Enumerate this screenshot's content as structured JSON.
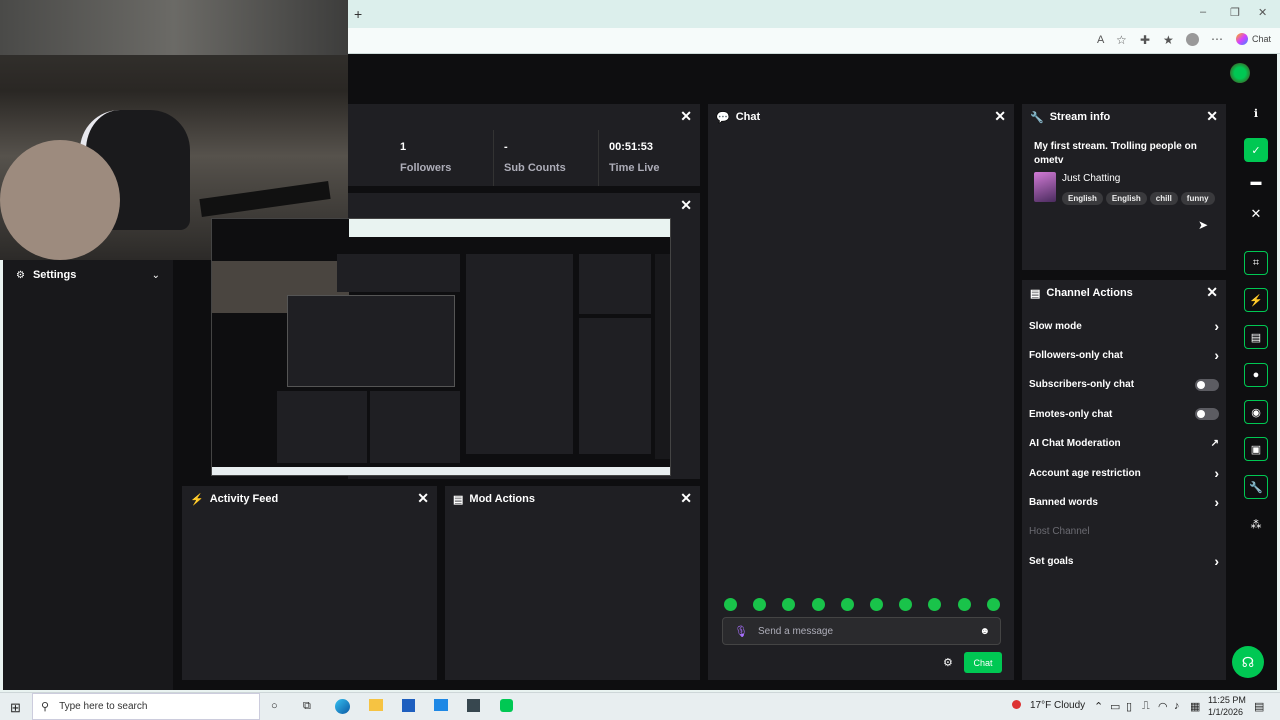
{
  "browser": {
    "new_tab": "+",
    "chat_label": "Chat",
    "window_controls": [
      "–",
      "❐",
      "✕"
    ]
  },
  "stats": {
    "panel_close": "✕",
    "followers_value": "1",
    "followers_label": "Followers",
    "subs_value": "-",
    "subs_label": "Sub Counts",
    "time_value": "00:51:53",
    "time_label": "Time Live"
  },
  "sidebar": {
    "settings_label": "Settings"
  },
  "chat": {
    "title": "Chat",
    "placeholder": "Send a message",
    "send_label": "Chat",
    "emote_count": 10
  },
  "stream_info": {
    "title": "Stream info",
    "stream_title": "My first stream. Trolling people on ometv",
    "category": "Just Chatting",
    "tags": [
      "English",
      "English",
      "chill",
      "funny"
    ]
  },
  "channel_actions": {
    "title": "Channel Actions",
    "items": [
      {
        "label": "Slow mode",
        "control": "chevron"
      },
      {
        "label": "Followers-only chat",
        "control": "chevron"
      },
      {
        "label": "Subscribers-only chat",
        "control": "toggle"
      },
      {
        "label": "Emotes-only chat",
        "control": "toggle"
      },
      {
        "label": "AI Chat Moderation",
        "control": "external"
      },
      {
        "label": "Account age restriction",
        "control": "chevron"
      },
      {
        "label": "Banned words",
        "control": "chevron"
      },
      {
        "label": "Host Channel",
        "control": "none"
      },
      {
        "label": "Set goals",
        "control": "chevron"
      }
    ]
  },
  "activity_feed": {
    "title": "Activity Feed"
  },
  "mod_actions": {
    "title": "Mod Actions"
  },
  "taskbar": {
    "search_placeholder": "Type here to search",
    "weather_temp": "17°F",
    "weather_desc": "Cloudy",
    "time": "11:25 PM",
    "date": "1/1/2026"
  },
  "colors": {
    "accent": "#00c853",
    "panel": "#1f1f23",
    "background": "#0e0e10"
  }
}
